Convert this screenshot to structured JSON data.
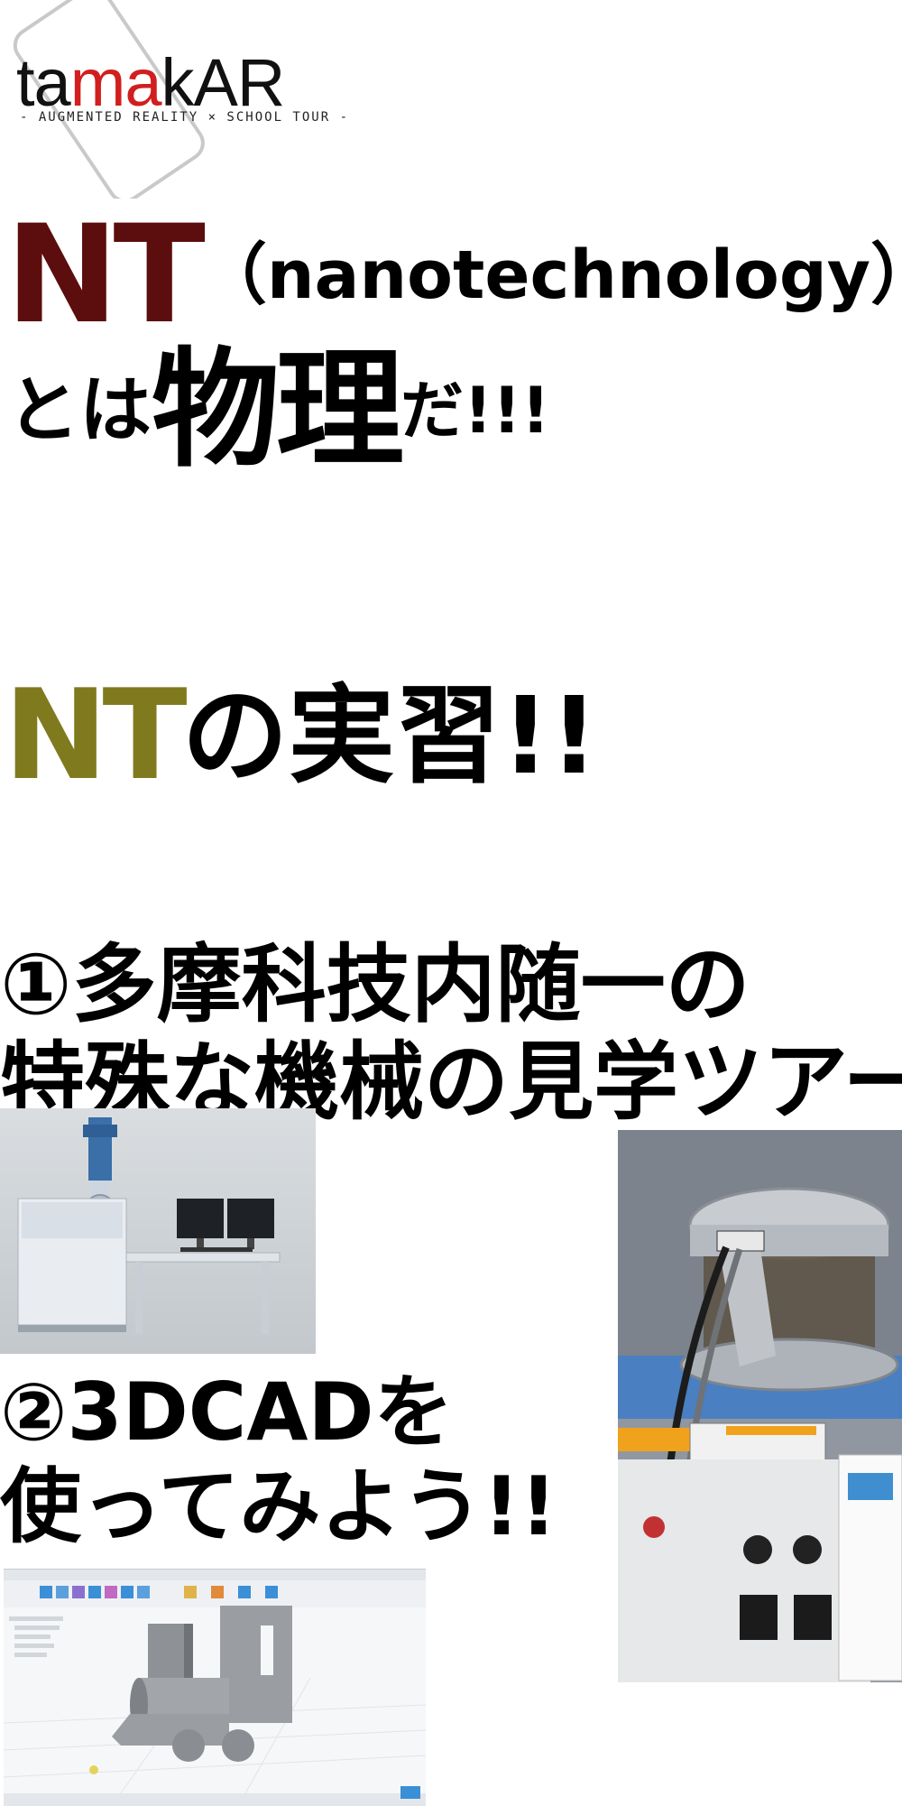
{
  "logo": {
    "wordmark_part1": "ta",
    "wordmark_part2": "ma",
    "wordmark_part3": "kAR",
    "tagline": "- AUGMENTED REALITY × SCHOOL TOUR -",
    "accent_color": "#d21e1e"
  },
  "headline1": {
    "nt": "NT",
    "paren": "（nanotechnology）",
    "toha": "とは",
    "butsuri": "物理",
    "da": "だ!!!",
    "nt_color": "#5c0d0d"
  },
  "headline2": {
    "nt": "NT",
    "rest": "の実習!!",
    "nt_color": "#807a1e"
  },
  "item1": {
    "line1": "①多摩科技内随一の",
    "line2": "特殊な機械の見学ツアー"
  },
  "item2": {
    "line1": "②3DCADを",
    "line2": "使ってみよう!!"
  },
  "photos": {
    "sem": "electron-microscope-photo",
    "chamber": "vacuum-chamber-photo",
    "cad": "cad-train-model-screenshot"
  }
}
